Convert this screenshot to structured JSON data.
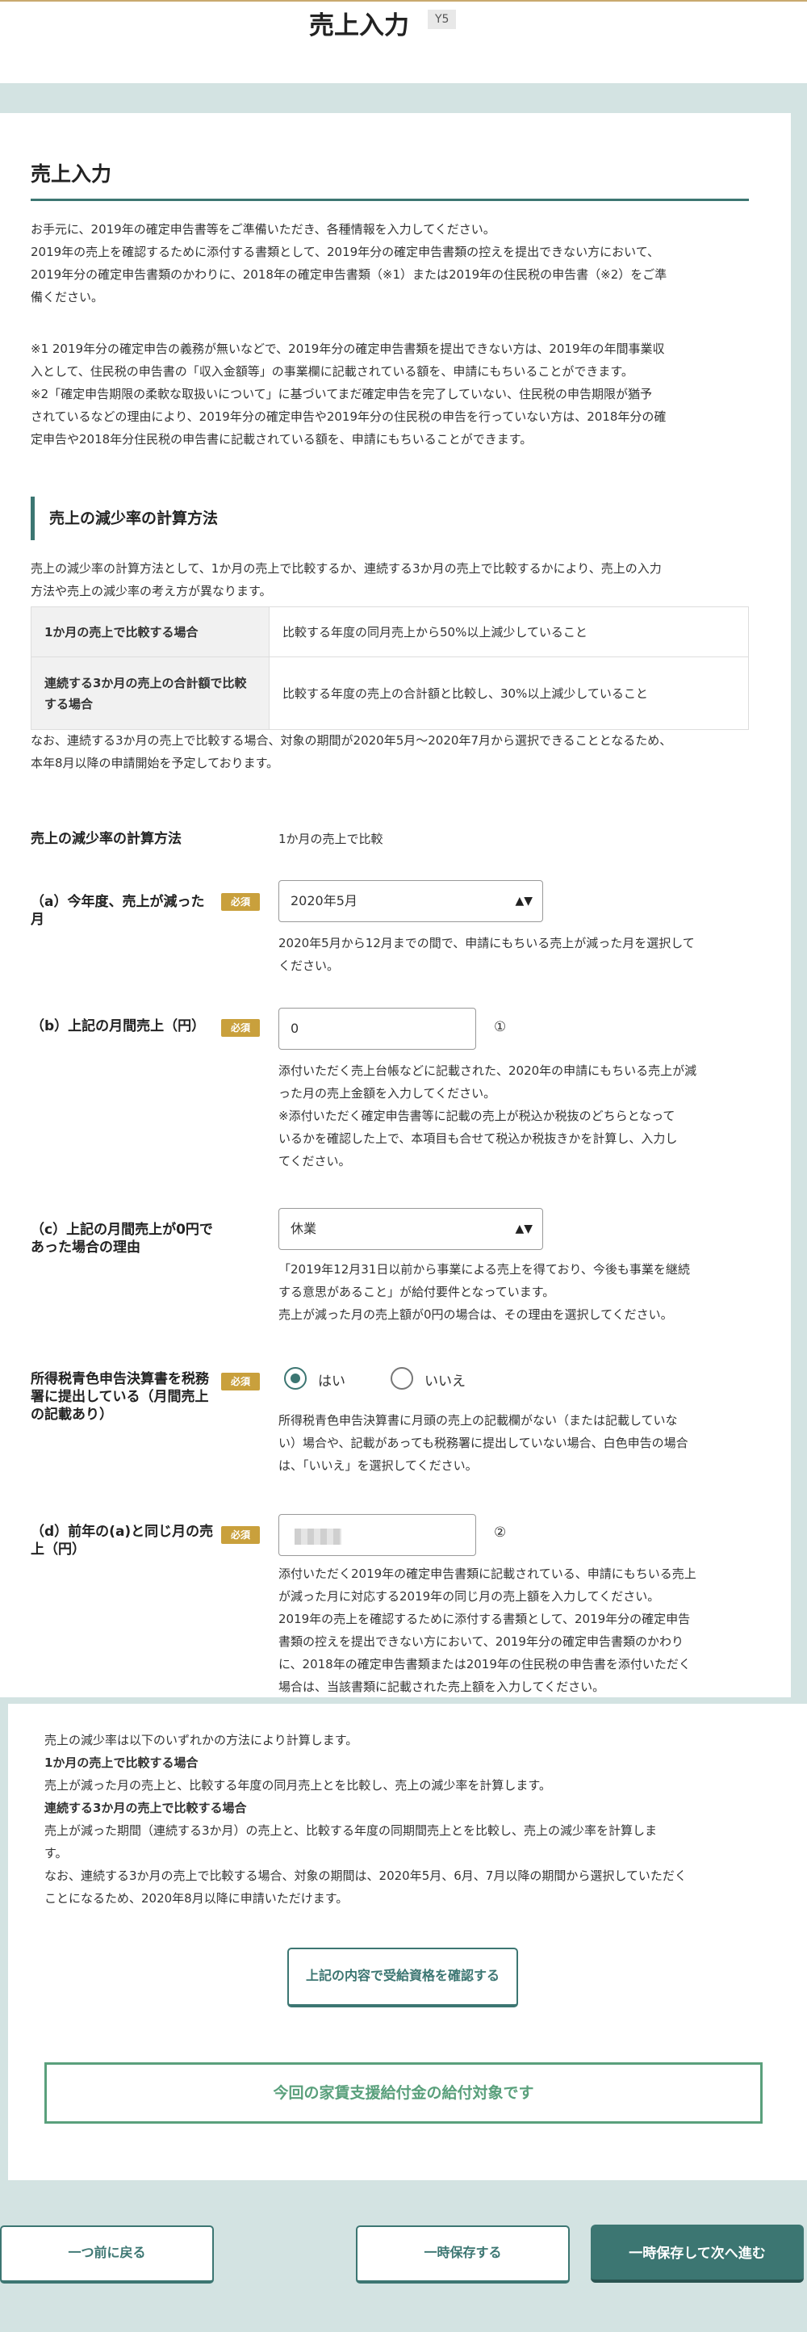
{
  "header": {
    "title": "売上入力",
    "badge": "Y5"
  },
  "section": {
    "title": "売上入力",
    "intro": [
      "お手元に、2019年の確定申告書等をご準備いただき、各種情報を入力してください。",
      "2019年の売上を確認するために添付する書類として、2019年分の確定申告書類の控えを提出できない方において、",
      "2019年分の確定申告書類のかわりに、2018年の確定申告書類（※1）または2019年の住民税の申告書（※2）をご準",
      "備ください。"
    ],
    "notes": [
      "※1 2019年分の確定申告の義務が無いなどで、2019年分の確定申告書類を提出できない方は、2019年の年間事業収",
      "入として、住民税の申告書の「収入金額等」の事業欄に記載されている額を、申請にもちいることができます。",
      "※2「確定申告期限の柔軟な取扱いについて」に基づいてまだ確定申告を完了していない、住民税の申告期限が猶予",
      "されているなどの理由により、2019年分の確定申告や2019年分の住民税の申告を行っていない方は、2018年分の確",
      "定申告や2018年分住民税の申告書に記載されている額を、申請にもちいることができます。"
    ]
  },
  "calc": {
    "heading": "売上の減少率の計算方法",
    "desc": [
      "売上の減少率の計算方法として、1か月の売上で比較するか、連続する3か月の売上で比較するかにより、売上の入力",
      "方法や売上の減少率の考え方が異なります。"
    ],
    "rows": [
      {
        "label": "1か月の売上で比較する場合",
        "value": "比較する年度の同月売上から50%以上減少していること"
      },
      {
        "label": "連続する3か月の売上の合計額で比較する場合",
        "value": "比較する年度の売上の合計額と比較し、30%以上減少していること"
      }
    ],
    "after": [
      "なお、連続する3か月の売上で比較する場合、対象の期間が2020年5月～2020年7月から選択できることとなるため、",
      "本年8月以降の申請開始を予定しております。"
    ]
  },
  "form": {
    "required_label": "必須",
    "method": {
      "label": "売上の減少率の計算方法",
      "value": "1か月の売上で比較"
    },
    "a": {
      "label": "（a）今年度、売上が減った月",
      "value": "2020年5月",
      "help": [
        "2020年5月から12月までの間で、申請にもちいる売上が減った月を選択して",
        "ください。"
      ]
    },
    "b": {
      "label": "（b）上記の月間売上（円）",
      "value": "0",
      "num": "①",
      "help": [
        "添付いただく売上台帳などに記載された、2020年の申請にもちいる売上が減",
        "った月の売上金額を入力してください。",
        "※添付いただく確定申告書等に記載の売上が税込か税抜のどちらとなって",
        "いるかを確認した上で、本項目も合せて税込か税抜きかを計算し、入力し",
        "てください。"
      ]
    },
    "c": {
      "label": "（c）上記の月間売上が0円であった場合の理由",
      "value": "休業",
      "help": [
        "「2019年12月31日以前から事業による売上を得ており、今後も事業を継続",
        "する意思があること」が給付要件となっています。",
        "売上が減った月の売上額が0円の場合は、その理由を選択してください。"
      ]
    },
    "blue": {
      "label": "所得税青色申告決算書を税務署に提出している（月間売上の記載あり）",
      "yes": "はい",
      "no": "いいえ",
      "help": [
        "所得税青色申告決算書に月頭の売上の記載欄がない（または記載していな",
        "い）場合や、記載があっても税務署に提出していない場合、白色申告の場合",
        "は、「いいえ」を選択してください。"
      ]
    },
    "d": {
      "label": "（d）前年の(a)と同じ月の売上（円）",
      "num": "②",
      "help": [
        "添付いただく2019年の確定申告書類に記載されている、申請にもちいる売上",
        "が減った月に対応する2019年の同じ月の売上額を入力してください。",
        "2019年の売上を確認するために添付する書類として、2019年分の確定申告",
        "書類の控えを提出できない方において、2019年分の確定申告書類のかわり",
        "に、2018年の確定申告書類または2019年の住民税の申告書を添付いただく",
        "場合は、当該書類に記載された売上額を入力してください。"
      ]
    }
  },
  "notes2": {
    "line1": "売上の減少率は以下のいずれかの方法により計算します。",
    "h1": "1か月の売上で比較する場合",
    "p1": "売上が減った月の売上と、比較する年度の同月売上とを比較し、売上の減少率を計算します。",
    "h2": "連続する3か月の売上で比較する場合",
    "p2a": "売上が減った期間（連続する3か月）の売上と、比較する年度の同期間売上とを比較し、売上の減少率を計算しま",
    "p2b": "す。",
    "p3a": "なお、連続する3か月の売上で比較する場合、対象の期間は、2020年5月、6月、7月以降の期間から選択していただく",
    "p3b": "ことになるため、2020年8月以降に申請いただけます。"
  },
  "buttons": {
    "check": "上記の内容で受給資格を確認する",
    "result": "今回の家賃支援給付金の給付対象です",
    "back": "一つ前に戻る",
    "save": "一時保存する",
    "save_next": "一時保存して次へ進む"
  }
}
